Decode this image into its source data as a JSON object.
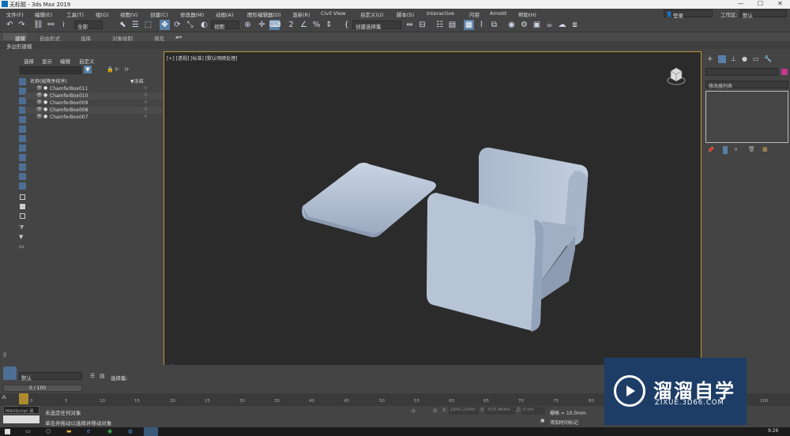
{
  "app": {
    "title": "无标题 - 3ds Max 2019"
  },
  "window": {
    "minimize": "—",
    "maximize": "☐",
    "close": "✕"
  },
  "menus": [
    "文件(F)",
    "编辑(E)",
    "工具(T)",
    "组(G)",
    "视图(V)",
    "创建(C)",
    "修改器(M)",
    "动画(A)",
    "图形编辑器(D)",
    "渲染(R)",
    "Civil View",
    "自定义(U)",
    "脚本(S)",
    "Interactive",
    "内容",
    "Arnold",
    "帮助(H)"
  ],
  "account": {
    "login": "登录",
    "workspace_label": "工作区:",
    "workspace_value": "默认"
  },
  "toolbar": {
    "filter": "全部",
    "refcoord": "视图",
    "selset": "创建选择集"
  },
  "ribbon": {
    "tabs": [
      "建模",
      "自由形式",
      "选择",
      "对象绘制",
      "填充"
    ],
    "sub": "多边形建模"
  },
  "scene_explorer": {
    "menu": [
      "选择",
      "显示",
      "编辑",
      "自定义"
    ],
    "col_name": "名称(按降序排序)",
    "col_freeze": "▼冻结",
    "items": [
      "ChamferBox011",
      "ChamferBox010",
      "ChamferBox009",
      "ChamferBox008",
      "ChamferBox007"
    ]
  },
  "viewport": {
    "label": "[+] [透视] [标准] [默认明暗处理]"
  },
  "command_panel": {
    "modifier_list": "修改器列表"
  },
  "status": {
    "layer": "默认",
    "selset_label": "选择集:",
    "frame": "0 / 100",
    "line1": "未选定任何对象",
    "line2": "单击并拖动以选择并移动对象",
    "maxscript": "MAXScript 迷",
    "grid": "栅格 = 10.0mm",
    "add_time_tag": "添加时间标记",
    "x": "1642.224m",
    "y": "-635.864m",
    "z": "0.0m",
    "clock": "9:26"
  },
  "timeline": {
    "ticks": [
      "0",
      "5",
      "10",
      "15",
      "20",
      "25",
      "30",
      "35",
      "40",
      "45",
      "50",
      "55",
      "60",
      "65",
      "70",
      "75",
      "80",
      "85",
      "90",
      "95",
      "100"
    ]
  },
  "watermark": {
    "title": "溜溜自学",
    "url": "ZIXUE.3D66.COM"
  },
  "colors": {
    "viewport_border": "#bb9a37",
    "selected_tool": "#5a7fa6",
    "watermark_bg": "#1d3d66",
    "object": "#b7c4d6"
  }
}
